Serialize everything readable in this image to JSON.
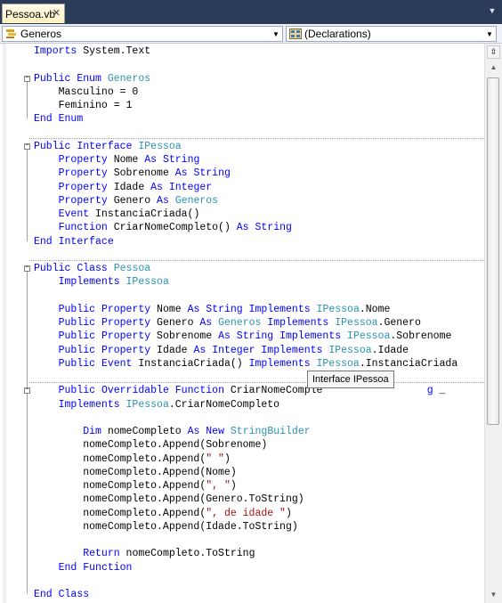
{
  "tab": {
    "title": "Pessoa.vb",
    "close": "✕"
  },
  "navbar": {
    "left_combo": "Generos",
    "right_combo": "(Declarations)"
  },
  "tooltip": "Interface IPessoa",
  "code_lines": [
    [
      {
        "t": "Imports",
        "c": "kw"
      },
      {
        "t": " System.Text"
      }
    ],
    [],
    [
      {
        "t": "Public",
        "c": "kw"
      },
      {
        "t": " "
      },
      {
        "t": "Enum",
        "c": "kw"
      },
      {
        "t": " "
      },
      {
        "t": "Generos",
        "c": "ty"
      }
    ],
    [
      {
        "t": "    Masculino = 0"
      }
    ],
    [
      {
        "t": "    Feminino = 1"
      }
    ],
    [
      {
        "t": "End",
        "c": "kw"
      },
      {
        "t": " "
      },
      {
        "t": "Enum",
        "c": "kw"
      }
    ],
    [],
    [
      {
        "t": "Public",
        "c": "kw"
      },
      {
        "t": " "
      },
      {
        "t": "Interface",
        "c": "kw"
      },
      {
        "t": " "
      },
      {
        "t": "IPessoa",
        "c": "ty"
      }
    ],
    [
      {
        "t": "    "
      },
      {
        "t": "Property",
        "c": "kw"
      },
      {
        "t": " Nome "
      },
      {
        "t": "As",
        "c": "kw"
      },
      {
        "t": " "
      },
      {
        "t": "String",
        "c": "kw"
      }
    ],
    [
      {
        "t": "    "
      },
      {
        "t": "Property",
        "c": "kw"
      },
      {
        "t": " Sobrenome "
      },
      {
        "t": "As",
        "c": "kw"
      },
      {
        "t": " "
      },
      {
        "t": "String",
        "c": "kw"
      }
    ],
    [
      {
        "t": "    "
      },
      {
        "t": "Property",
        "c": "kw"
      },
      {
        "t": " Idade "
      },
      {
        "t": "As",
        "c": "kw"
      },
      {
        "t": " "
      },
      {
        "t": "Integer",
        "c": "kw"
      }
    ],
    [
      {
        "t": "    "
      },
      {
        "t": "Property",
        "c": "kw"
      },
      {
        "t": " Genero "
      },
      {
        "t": "As",
        "c": "kw"
      },
      {
        "t": " "
      },
      {
        "t": "Generos",
        "c": "ty"
      }
    ],
    [
      {
        "t": "    "
      },
      {
        "t": "Event",
        "c": "kw"
      },
      {
        "t": " InstanciaCriada()"
      }
    ],
    [
      {
        "t": "    "
      },
      {
        "t": "Function",
        "c": "kw"
      },
      {
        "t": " CriarNomeCompleto() "
      },
      {
        "t": "As",
        "c": "kw"
      },
      {
        "t": " "
      },
      {
        "t": "String",
        "c": "kw"
      }
    ],
    [
      {
        "t": "End",
        "c": "kw"
      },
      {
        "t": " "
      },
      {
        "t": "Interface",
        "c": "kw"
      }
    ],
    [],
    [
      {
        "t": "Public",
        "c": "kw"
      },
      {
        "t": " "
      },
      {
        "t": "Class",
        "c": "kw"
      },
      {
        "t": " "
      },
      {
        "t": "Pessoa",
        "c": "ty"
      }
    ],
    [
      {
        "t": "    "
      },
      {
        "t": "Implements",
        "c": "kw"
      },
      {
        "t": " "
      },
      {
        "t": "IPessoa",
        "c": "ty"
      }
    ],
    [],
    [
      {
        "t": "    "
      },
      {
        "t": "Public",
        "c": "kw"
      },
      {
        "t": " "
      },
      {
        "t": "Property",
        "c": "kw"
      },
      {
        "t": " Nome "
      },
      {
        "t": "As",
        "c": "kw"
      },
      {
        "t": " "
      },
      {
        "t": "String",
        "c": "kw"
      },
      {
        "t": " "
      },
      {
        "t": "Implements",
        "c": "kw"
      },
      {
        "t": " "
      },
      {
        "t": "IPessoa",
        "c": "ty"
      },
      {
        "t": ".Nome"
      }
    ],
    [
      {
        "t": "    "
      },
      {
        "t": "Public",
        "c": "kw"
      },
      {
        "t": " "
      },
      {
        "t": "Property",
        "c": "kw"
      },
      {
        "t": " Genero "
      },
      {
        "t": "As",
        "c": "kw"
      },
      {
        "t": " "
      },
      {
        "t": "Generos",
        "c": "ty"
      },
      {
        "t": " "
      },
      {
        "t": "Implements",
        "c": "kw"
      },
      {
        "t": " "
      },
      {
        "t": "IPessoa",
        "c": "ty"
      },
      {
        "t": ".Genero"
      }
    ],
    [
      {
        "t": "    "
      },
      {
        "t": "Public",
        "c": "kw"
      },
      {
        "t": " "
      },
      {
        "t": "Property",
        "c": "kw"
      },
      {
        "t": " Sobrenome "
      },
      {
        "t": "As",
        "c": "kw"
      },
      {
        "t": " "
      },
      {
        "t": "String",
        "c": "kw"
      },
      {
        "t": " "
      },
      {
        "t": "Implements",
        "c": "kw"
      },
      {
        "t": " "
      },
      {
        "t": "IPessoa",
        "c": "ty"
      },
      {
        "t": ".Sobrenome"
      }
    ],
    [
      {
        "t": "    "
      },
      {
        "t": "Public",
        "c": "kw"
      },
      {
        "t": " "
      },
      {
        "t": "Property",
        "c": "kw"
      },
      {
        "t": " Idade "
      },
      {
        "t": "As",
        "c": "kw"
      },
      {
        "t": " "
      },
      {
        "t": "Integer",
        "c": "kw"
      },
      {
        "t": " "
      },
      {
        "t": "Implements",
        "c": "kw"
      },
      {
        "t": " "
      },
      {
        "t": "IPessoa",
        "c": "ty"
      },
      {
        "t": ".Idade"
      }
    ],
    [
      {
        "t": "    "
      },
      {
        "t": "Public",
        "c": "kw"
      },
      {
        "t": " "
      },
      {
        "t": "Event",
        "c": "kw"
      },
      {
        "t": " InstanciaCriada() "
      },
      {
        "t": "Implements",
        "c": "kw"
      },
      {
        "t": " "
      },
      {
        "t": "IPessoa",
        "c": "ty"
      },
      {
        "t": ".InstanciaCriada"
      }
    ],
    [],
    [
      {
        "t": "    "
      },
      {
        "t": "Public",
        "c": "kw"
      },
      {
        "t": " "
      },
      {
        "t": "Overridable",
        "c": "kw"
      },
      {
        "t": " "
      },
      {
        "t": "Function",
        "c": "kw"
      },
      {
        "t": " CriarNomeComple"
      },
      {
        "t": "                 "
      },
      {
        "t": "g",
        "c": "kw"
      },
      {
        "t": " _"
      }
    ],
    [
      {
        "t": "    "
      },
      {
        "t": "Implements",
        "c": "kw"
      },
      {
        "t": " "
      },
      {
        "t": "IPessoa",
        "c": "ty"
      },
      {
        "t": ".CriarNomeCompleto"
      }
    ],
    [],
    [
      {
        "t": "        "
      },
      {
        "t": "Dim",
        "c": "kw"
      },
      {
        "t": " nomeCompleto "
      },
      {
        "t": "As",
        "c": "kw"
      },
      {
        "t": " "
      },
      {
        "t": "New",
        "c": "kw"
      },
      {
        "t": " "
      },
      {
        "t": "StringBuilder",
        "c": "ty"
      }
    ],
    [
      {
        "t": "        nomeCompleto.Append(Sobrenome)"
      }
    ],
    [
      {
        "t": "        nomeCompleto.Append("
      },
      {
        "t": "\" \"",
        "c": "st"
      },
      {
        "t": ")"
      }
    ],
    [
      {
        "t": "        nomeCompleto.Append(Nome)"
      }
    ],
    [
      {
        "t": "        nomeCompleto.Append("
      },
      {
        "t": "\", \"",
        "c": "st"
      },
      {
        "t": ")"
      }
    ],
    [
      {
        "t": "        nomeCompleto.Append(Genero.ToString)"
      }
    ],
    [
      {
        "t": "        nomeCompleto.Append("
      },
      {
        "t": "\", de idade \"",
        "c": "st"
      },
      {
        "t": ")"
      }
    ],
    [
      {
        "t": "        nomeCompleto.Append(Idade.ToString)"
      }
    ],
    [],
    [
      {
        "t": "        "
      },
      {
        "t": "Return",
        "c": "kw"
      },
      {
        "t": " nomeCompleto.ToString"
      }
    ],
    [
      {
        "t": "    "
      },
      {
        "t": "End",
        "c": "kw"
      },
      {
        "t": " "
      },
      {
        "t": "Function",
        "c": "kw"
      }
    ],
    [],
    [
      {
        "t": "End",
        "c": "kw"
      },
      {
        "t": " "
      },
      {
        "t": "Class",
        "c": "kw"
      }
    ]
  ]
}
